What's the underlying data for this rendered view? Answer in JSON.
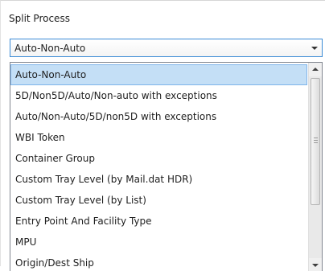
{
  "group": {
    "label": "Split Process"
  },
  "combo": {
    "selected": "Auto-Non-Auto"
  },
  "options": [
    "Auto-Non-Auto",
    "5D/Non5D/Auto/Non-auto with exceptions",
    "Auto/Non-Auto/5D/non5D with exceptions",
    "WBI Token",
    "Container Group",
    "Custom Tray Level (by Mail.dat HDR)",
    "Custom Tray Level (by List)",
    "Entry Point And Facility Type",
    "MPU",
    "Origin/Dest Ship"
  ],
  "colors": {
    "accent": "#3b8bd6",
    "selection": "#c4dff6"
  }
}
